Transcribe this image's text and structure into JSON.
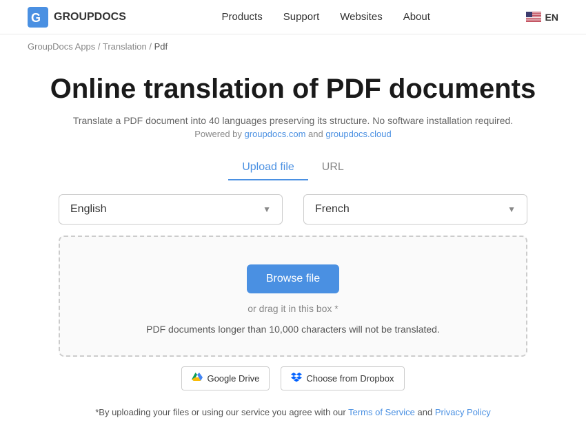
{
  "header": {
    "logo_text": "GROUPDOCS",
    "nav": {
      "products": "Products",
      "support": "Support",
      "websites": "Websites",
      "about": "About"
    },
    "lang_code": "EN"
  },
  "breadcrumb": {
    "part1": "GroupDocs Apps",
    "separator1": " / ",
    "part2": "Translation",
    "separator2": " / ",
    "current": "Pdf"
  },
  "main": {
    "title": "Online translation of PDF documents",
    "subtitle": "Translate a PDF document into 40 languages preserving its structure. No software installation required.",
    "powered_label": "Powered by ",
    "powered_link1": "groupdocs.com",
    "powered_and": " and ",
    "powered_link2": "groupdocs.cloud",
    "tabs": {
      "upload": "Upload file",
      "url": "URL"
    },
    "source_lang": "English",
    "target_lang": "French",
    "browse_btn": "Browse file",
    "drag_text": "or drag it in this box *",
    "limit_text": "PDF documents longer than 10,000 characters will not be translated.",
    "gdrive_btn": "Google Drive",
    "dropbox_btn": "Choose from Dropbox",
    "footer_note_prefix": "*By uploading your files or using our service you agree with our ",
    "tos_link": "Terms of Service",
    "footer_and": " and ",
    "privacy_link": "Privacy Policy"
  }
}
